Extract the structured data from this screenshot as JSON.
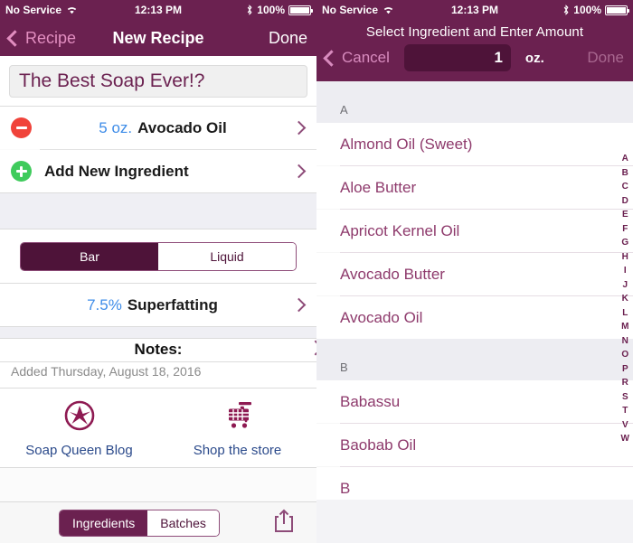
{
  "left": {
    "statusbar": {
      "carrier": "No Service",
      "wifi_icon": "wifi-icon",
      "time": "12:13 PM",
      "bluetooth_icon": "bluetooth-icon",
      "battery": "100%"
    },
    "nav": {
      "back_label": "Recipe",
      "title": "New Recipe",
      "done_label": "Done"
    },
    "recipe_title": "The Best Soap Ever!?",
    "ingredients": [
      {
        "icon": "minus-circle-icon",
        "amount": "5 oz.",
        "name": "Avocado Oil"
      }
    ],
    "add_row": {
      "icon": "plus-circle-icon",
      "label": "Add New Ingredient"
    },
    "type_segment": {
      "options": [
        "Bar",
        "Liquid"
      ],
      "selected": "Bar"
    },
    "superfat": {
      "value": "7.5%",
      "label": "Superfatting"
    },
    "notes": {
      "title": "Notes:",
      "added": "Added Thursday, August 18, 2016"
    },
    "links": [
      {
        "icon": "soap-queen-logo-icon",
        "label": "Soap Queen Blog"
      },
      {
        "icon": "shopping-cart-icon",
        "label": "Shop the store"
      }
    ],
    "bottom_segment": {
      "options": [
        "Ingredients",
        "Batches"
      ],
      "selected": "Ingredients"
    },
    "share_icon": "share-icon"
  },
  "right": {
    "statusbar": {
      "carrier": "No Service",
      "wifi_icon": "wifi-icon",
      "time": "12:13 PM",
      "bluetooth_icon": "bluetooth-icon",
      "battery": "100%"
    },
    "nav": {
      "title": "Select Ingredient and Enter Amount",
      "cancel_label": "Cancel",
      "amount_value": "1",
      "amount_unit": "oz.",
      "done_label": "Done"
    },
    "sections": [
      {
        "letter": "A",
        "items": [
          "Almond Oil (Sweet)",
          "Aloe Butter",
          "Apricot Kernel Oil",
          "Avocado Butter",
          "Avocado Oil"
        ]
      },
      {
        "letter": "B",
        "items": [
          "Babassu",
          "Baobab Oil",
          "B"
        ]
      }
    ],
    "index": [
      "A",
      "B",
      "C",
      "D",
      "E",
      "F",
      "G",
      "H",
      "I",
      "J",
      "K",
      "L",
      "M",
      "N",
      "O",
      "P",
      "R",
      "S",
      "T",
      "V",
      "W"
    ]
  },
  "colors": {
    "brand_purple": "#6B2150",
    "dark_purple": "#4E1339",
    "link_blue": "#2B4A8B",
    "amount_blue": "#3E8CE8",
    "minus_red": "#F0433A",
    "plus_green": "#3FCB5C",
    "list_text_purple": "#8E3A6C"
  }
}
